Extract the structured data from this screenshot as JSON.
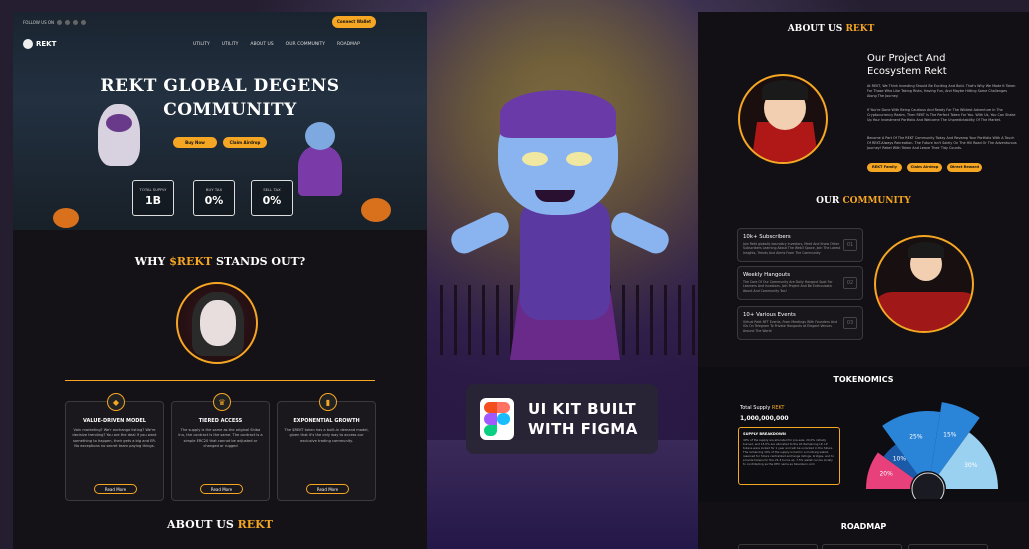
{
  "left": {
    "follow_label": "FOLLOW US ON",
    "connect_wallet": "Connect Wallet",
    "logo": "REKT",
    "nav": [
      "UTILITY",
      "UTILITY",
      "ABOUT US",
      "OUR COMMUNITY",
      "ROADMAP"
    ],
    "hero_line1": "REKT GLOBAL DEGENS",
    "hero_line2": "COMMUNITY",
    "buy_now": "Buy Now",
    "claim_airdrop": "Claim Airdrop",
    "stats": [
      {
        "label": "TOTAL SUPPLY",
        "value": "1B"
      },
      {
        "label": "BUY TAX",
        "value": "0%"
      },
      {
        "label": "SELL TAX",
        "value": "0%"
      }
    ],
    "why_prefix": "WHY",
    "why_highlight": "$REKT",
    "why_suffix": "STANDS OUT?",
    "cards": [
      {
        "title": "VALUE-DRIVEN MODEL",
        "text": "Vain marketing? We'r exchange listing? We're decisive trending? You are the deal if you want something to happen, their gets a big and ER. No exceptions no secret team paying things.",
        "button": "Read More",
        "icon": "diamond-icon"
      },
      {
        "title": "TIERED ACCESS",
        "text": "The supply is the same as the original Shiba Inu, the contract is the same. The contract is a simple ERC20 that cannot be adjusted or changed or rugged",
        "button": "Read More",
        "icon": "crown-icon"
      },
      {
        "title": "EXPONENTIAL GROWTH",
        "text": "The $REKT token has a built-in demand model, given that it's the only way to access our exclusive trading community.",
        "button": "Read More",
        "icon": "chart-icon"
      }
    ],
    "about_prefix": "ABOUT US",
    "about_highlight": "REKT"
  },
  "center": {
    "badge_line1": "UI KIT BUILT",
    "badge_line2": "WITH FIGMA"
  },
  "right": {
    "about_prefix": "ABOUT US",
    "about_highlight": "REKT",
    "project_title_1": "Our Project And",
    "project_title_2": "Ecosystem Rekt",
    "para1": "At REKT, We Think Investing Should Be Exciting And Bold. That's Why We Made It Token For Those Who Like Taking Risks, Having Fun, And Maybe Hitting Some Challenges Along The Journey.",
    "para2": "If You're Done With Being Cautious And Ready For The Wildest Adventure In The Cryptocurrency Realm, Then REKT Is The Perfect Token For You. With Us, You Can Shake Up Your Investment Portfolio And Welcome The Unpredictability Of The Market.",
    "para3": "Become A Part Of The REKT Community Today And Revamp Your Portfolio With A Touch Of REKT-Always Recreation. The Future Isn't Solely On The Hill Road Or The Adventurous Journey! Rebel With Token And Leave Their Tidy Counts.",
    "btns": [
      "REKT Family",
      "Claim Airdrop",
      "Direct Reward"
    ],
    "community_prefix": "OUR",
    "community_highlight": "COMMUNITY",
    "community": [
      {
        "title": "10k+ Subscribers",
        "text": "Join Rekt globally boundary investors, Meet And Know Other Subscribers Learning About The Web3 Space, Join The Latest Insights, Trends And Alerts From The Community",
        "num": "01"
      },
      {
        "title": "Weekly Hangouts",
        "text": "The Core Of Our Community Are Daily Hangout Spot For Learners And Investors. Join Project And Be Enthusiastic About And Community Too!",
        "num": "02"
      },
      {
        "title": "10+ Various Events",
        "text": "Virtual Rekt NFT Events, From Meetings With Founders And IGs On Telegram To Private Hangouts at Elegant Venues Around The World",
        "num": "03"
      }
    ],
    "tokenomics_title": "TOKENOMICS",
    "total_supply_prefix": "Total Supply",
    "total_supply_highlight": "REKT",
    "total_supply_value": "1,000,000,000",
    "supply_breakdown_title": "SUPPLY BREAKDOWN",
    "supply_breakdown_text": "40% of the supply are allocated for pre-sale. 20.0% initially burned, and 15.0% are allocated to the LP. Remaining LP, LP tokens were locked for 1 year and will be unlocked in the future. The remaining 10% of the supply is held in a multi-sig wallet, reserved for future centralized exchange listings, bridges, and to provide tokens for the V2-3 burns up. 7.5% wallet can be locally to contributing as the DEX name as tokenburn.com",
    "roadmap_title": "ROADMAP"
  },
  "chart_data": {
    "type": "pie",
    "values": [
      20,
      10,
      25,
      15,
      30
    ],
    "labels": [
      "20%",
      "10%",
      "25%",
      "15%",
      "30%"
    ],
    "colors": [
      "#e8407a",
      "#1a5aa8",
      "#2a84d8",
      "#2a84d8",
      "#9ad0f0"
    ]
  }
}
